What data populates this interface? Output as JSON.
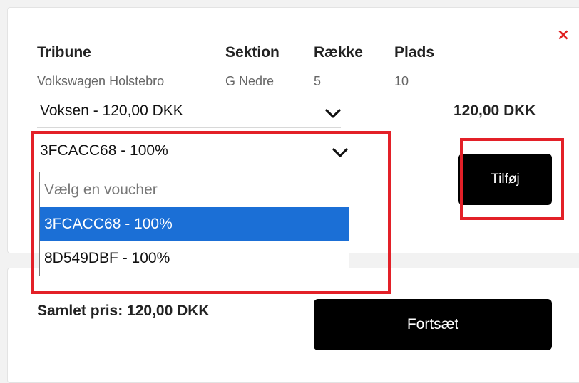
{
  "close_symbol": "×",
  "seat": {
    "headers": {
      "tribune": "Tribune",
      "section": "Sektion",
      "row": "Række",
      "seat": "Plads"
    },
    "values": {
      "tribune": "Volkswagen Holstebro",
      "section": "G Nedre",
      "row": "5",
      "seat": "10"
    }
  },
  "price_select": {
    "value": "Voksen - 120,00 DKK"
  },
  "line_price": "120,00 DKK",
  "voucher_select": {
    "value": "3FCACC68 - 100%",
    "options": [
      "Vælg en voucher",
      "3FCACC68 - 100%",
      "8D549DBF - 100%"
    ],
    "highlighted_index": 1
  },
  "add_button": "Tilføj",
  "total": {
    "label": "Samlet pris: 120,00 DKK"
  },
  "continue_button": "Fortsæt",
  "colors": {
    "highlight": "#e32028",
    "close": "#e02020",
    "selected_option": "#1b6fd6",
    "button_bg": "#000000"
  },
  "icons": {
    "close": "close-icon",
    "dropdown": "chevron-down-icon"
  }
}
